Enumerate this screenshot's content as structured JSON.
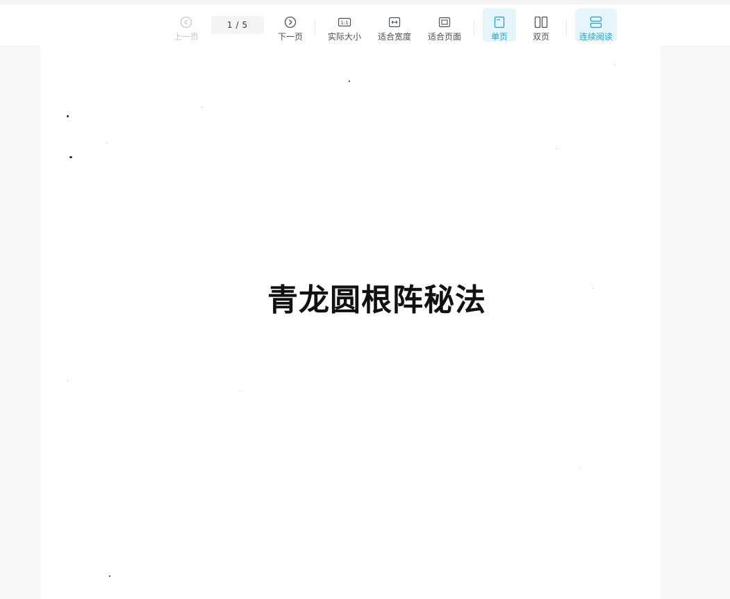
{
  "toolbar": {
    "prev_label": "上一页",
    "current_page": "1",
    "page_separator": "/",
    "total_pages": "5",
    "next_label": "下一页",
    "actual_size_label": "实际大小",
    "actual_size_icon_text": "1:1",
    "fit_width_label": "适合宽度",
    "fit_page_label": "适合页面",
    "single_page_label": "单页",
    "double_page_label": "双页",
    "continuous_label": "连续阅读"
  },
  "document": {
    "title": "青龙圆根阵秘法"
  },
  "colors": {
    "accent": "#1fa3d6",
    "active_bg": "#e6f5fb",
    "viewer_bg": "#f6f8fa",
    "disabled": "#c3c7cc"
  }
}
